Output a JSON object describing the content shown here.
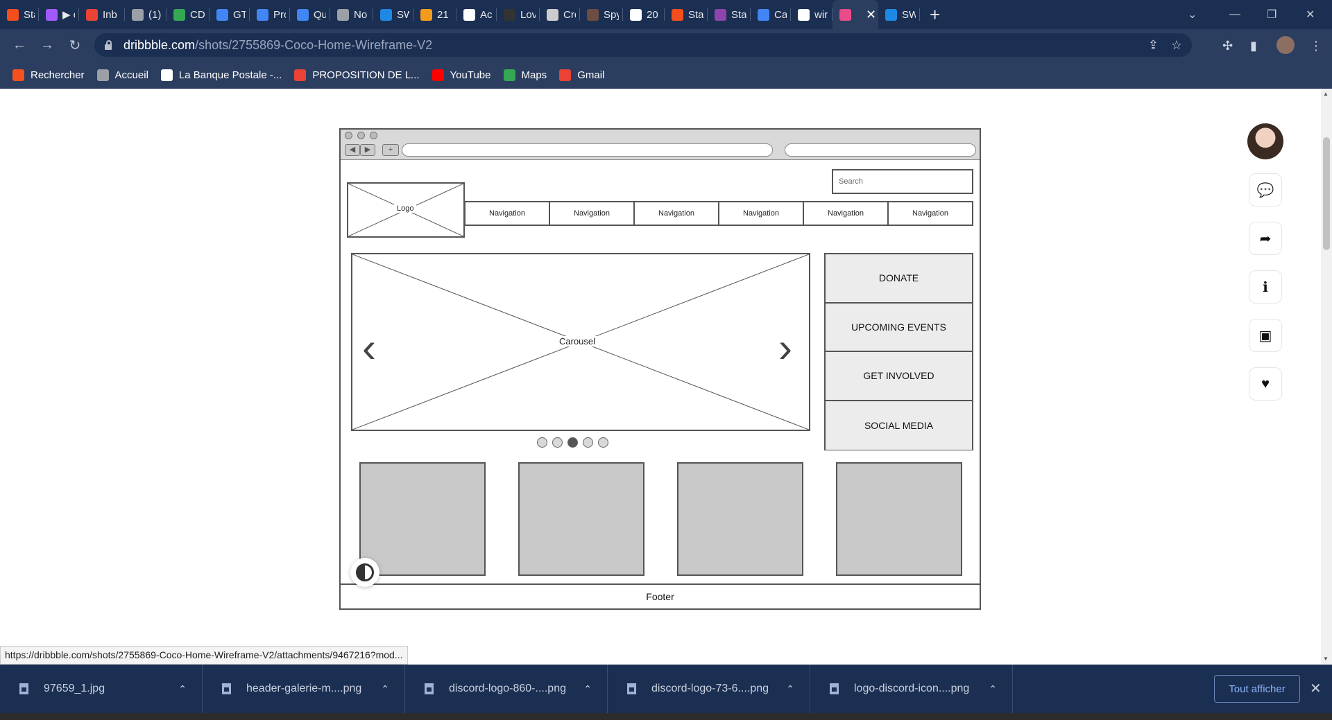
{
  "tabs": [
    {
      "label": "Sta",
      "icon": "figma-icon",
      "color": "#f24e1e"
    },
    {
      "label": "▶ c",
      "icon": "figma-icon",
      "color": "#a259ff"
    },
    {
      "label": "Inb",
      "icon": "gmail-icon",
      "color": "#ea4335"
    },
    {
      "label": "(1)",
      "icon": "tool-icon",
      "color": "#9aa0a6"
    },
    {
      "label": "CD",
      "icon": "drive-icon",
      "color": "#34a853"
    },
    {
      "label": "GT",
      "icon": "docs-icon",
      "color": "#4285f4"
    },
    {
      "label": "Pro",
      "icon": "docs-icon",
      "color": "#4285f4"
    },
    {
      "label": "Qu",
      "icon": "docs-icon",
      "color": "#4285f4"
    },
    {
      "label": "No",
      "icon": "globe-icon",
      "color": "#9aa0a6"
    },
    {
      "label": "SW",
      "icon": "swoosh-icon",
      "color": "#1e88e5"
    },
    {
      "label": "21",
      "icon": "orange-icon",
      "color": "#f29c1f"
    },
    {
      "label": "Acc",
      "icon": "a-icon",
      "color": "#ffffff"
    },
    {
      "label": "Lov",
      "icon": "github-icon",
      "color": "#333333"
    },
    {
      "label": "Cré",
      "icon": "cloud-icon",
      "color": "#cccccc"
    },
    {
      "label": "Spy",
      "icon": "spy-icon",
      "color": "#6d4c41"
    },
    {
      "label": "20",
      "icon": "w-icon",
      "color": "#ffffff"
    },
    {
      "label": "Sta",
      "icon": "figma-icon",
      "color": "#f24e1e"
    },
    {
      "label": "Sta",
      "icon": "purple-icon",
      "color": "#8e44ad"
    },
    {
      "label": "Cal",
      "icon": "docs-icon",
      "color": "#4285f4"
    },
    {
      "label": "wir",
      "icon": "google-icon",
      "color": "#ffffff"
    },
    {
      "label": "",
      "icon": "dribbble-icon",
      "color": "#ea4c89",
      "active": true
    },
    {
      "label": "SW",
      "icon": "swoosh-icon",
      "color": "#1e88e5"
    }
  ],
  "url": {
    "domain": "dribbble.com",
    "path": "/shots/2755869-Coco-Home-Wireframe-V2"
  },
  "bookmarks": [
    {
      "label": "Rechercher",
      "icon": "search-bookmark-icon",
      "color": "#f4511e"
    },
    {
      "label": "Accueil",
      "icon": "globe-icon",
      "color": "#9aa0a6"
    },
    {
      "label": "La Banque Postale -...",
      "icon": "bank-icon",
      "color": "#ffffff"
    },
    {
      "label": "PROPOSITION DE L...",
      "icon": "gmail-icon",
      "color": "#ea4335"
    },
    {
      "label": "YouTube",
      "icon": "youtube-icon",
      "color": "#ff0000"
    },
    {
      "label": "Maps",
      "icon": "maps-icon",
      "color": "#34a853"
    },
    {
      "label": "Gmail",
      "icon": "gmail-icon",
      "color": "#ea4335"
    }
  ],
  "wireframe": {
    "logo": "Logo",
    "search_placeholder": "Search",
    "nav": [
      "Navigation",
      "Navigation",
      "Navigation",
      "Navigation",
      "Navigation",
      "Navigation"
    ],
    "carousel": "Carousel",
    "side_buttons": [
      "DONATE",
      "UPCOMING EVENTS",
      "GET INVOLVED",
      "SOCIAL MEDIA"
    ],
    "pager_active_index": 2,
    "pager_count": 5,
    "footer": "Footer"
  },
  "status_url": "https://dribbble.com/shots/2755869-Coco-Home-Wireframe-V2/attachments/9467216?mod...",
  "downloads": [
    "97659_1.jpg",
    "header-galerie-m....png",
    "discord-logo-860-....png",
    "discord-logo-73-6....png",
    "logo-discord-icon....png"
  ],
  "show_all": "Tout afficher"
}
